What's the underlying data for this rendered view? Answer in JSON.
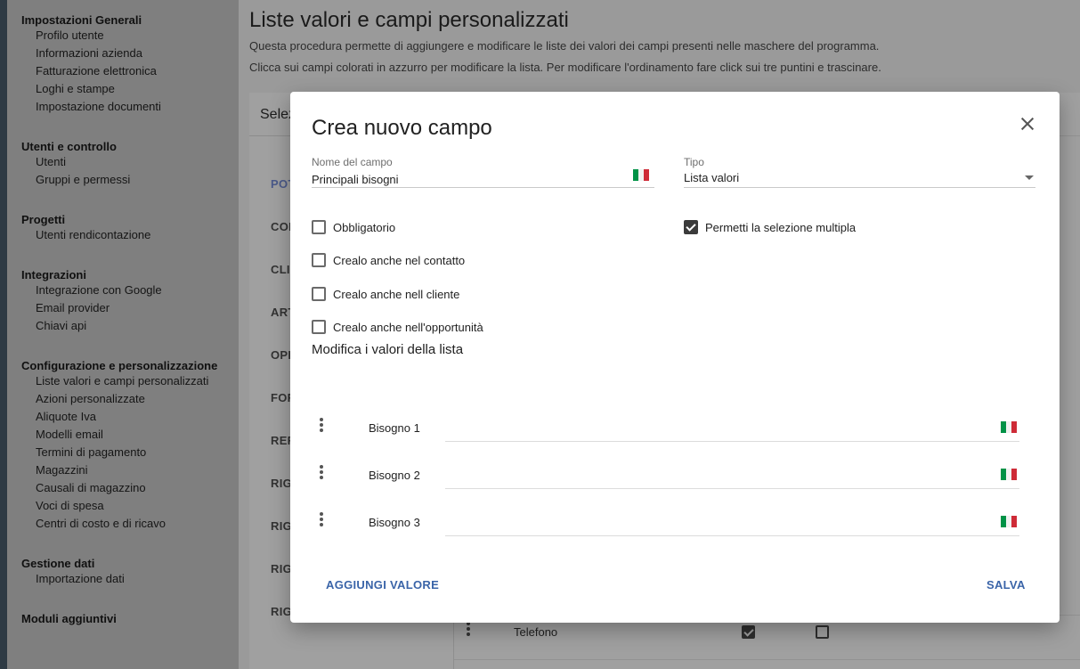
{
  "sidebar": {
    "groups": [
      {
        "title": "Impostazioni Generali",
        "items": [
          "Profilo utente",
          "Informazioni azienda",
          "Fatturazione elettronica",
          "Loghi e stampe",
          "Impostazione documenti"
        ]
      },
      {
        "title": "Utenti e controllo",
        "items": [
          "Utenti",
          "Gruppi e permessi"
        ]
      },
      {
        "title": "Progetti",
        "items": [
          "Utenti rendicontazione"
        ]
      },
      {
        "title": "Integrazioni",
        "items": [
          "Integrazione con Google",
          "Email provider",
          "Chiavi api"
        ]
      },
      {
        "title": "Configurazione e personalizzazione",
        "items": [
          "Liste valori e campi personalizzati",
          "Azioni personalizzate",
          "Aliquote Iva",
          "Modelli email",
          "Termini di pagamento",
          "Magazzini",
          "Causali di magazzino",
          "Voci di spesa",
          "Centri di costo e di ricavo"
        ]
      },
      {
        "title": "Gestione dati",
        "items": [
          "Importazione dati"
        ]
      },
      {
        "title": "Moduli aggiuntivi",
        "items": []
      }
    ]
  },
  "main": {
    "title": "Liste valori e campi personalizzati",
    "desc1": "Questa procedura permette di aggiungere e modificare le liste dei valori dei campi presenti nelle maschere del programma.",
    "desc2": "Clicca sui campi colorati in azzurro per modificare la lista. Per modificare l'ordinamento fare click sui tre puntini e trascinare.",
    "panel_header": "Selez",
    "tabs": [
      "POT",
      "CON",
      "CLI",
      "ART",
      "OPP",
      "FOR",
      "REF",
      "RIG",
      "RIG",
      "RIG",
      "RIG"
    ],
    "bottom_row": {
      "label": "Telefono",
      "check1": true,
      "check2": false
    }
  },
  "modal": {
    "title": "Crea nuovo campo",
    "name_label": "Nome del campo",
    "name_value": "Principali bisogni",
    "type_label": "Tipo",
    "type_value": "Lista valori",
    "checkboxes": {
      "required": {
        "label": "Obbligatorio",
        "checked": false
      },
      "contact": {
        "label": "Crealo anche nel contatto",
        "checked": false
      },
      "client": {
        "label": "Crealo anche nell cliente",
        "checked": false
      },
      "opportunity": {
        "label": "Crealo anche nell'opportunità",
        "checked": false
      },
      "multiple": {
        "label": "Permetti la selezione multipla",
        "checked": true
      }
    },
    "section_title": "Modifica i valori della lista",
    "values": [
      "Bisogno 1",
      "Bisogno 2",
      "Bisogno 3"
    ],
    "add_button": "AGGIUNGI VALORE",
    "save_button": "SALVA"
  },
  "colors": {
    "accent": "#3a64a8",
    "flag_green": "#009246",
    "flag_red": "#ce2b37"
  },
  "icons": {
    "close": "close-icon",
    "drag": "drag-handle-icon",
    "flag": "italian-flag-icon",
    "dropdown": "chevron-down-icon"
  }
}
